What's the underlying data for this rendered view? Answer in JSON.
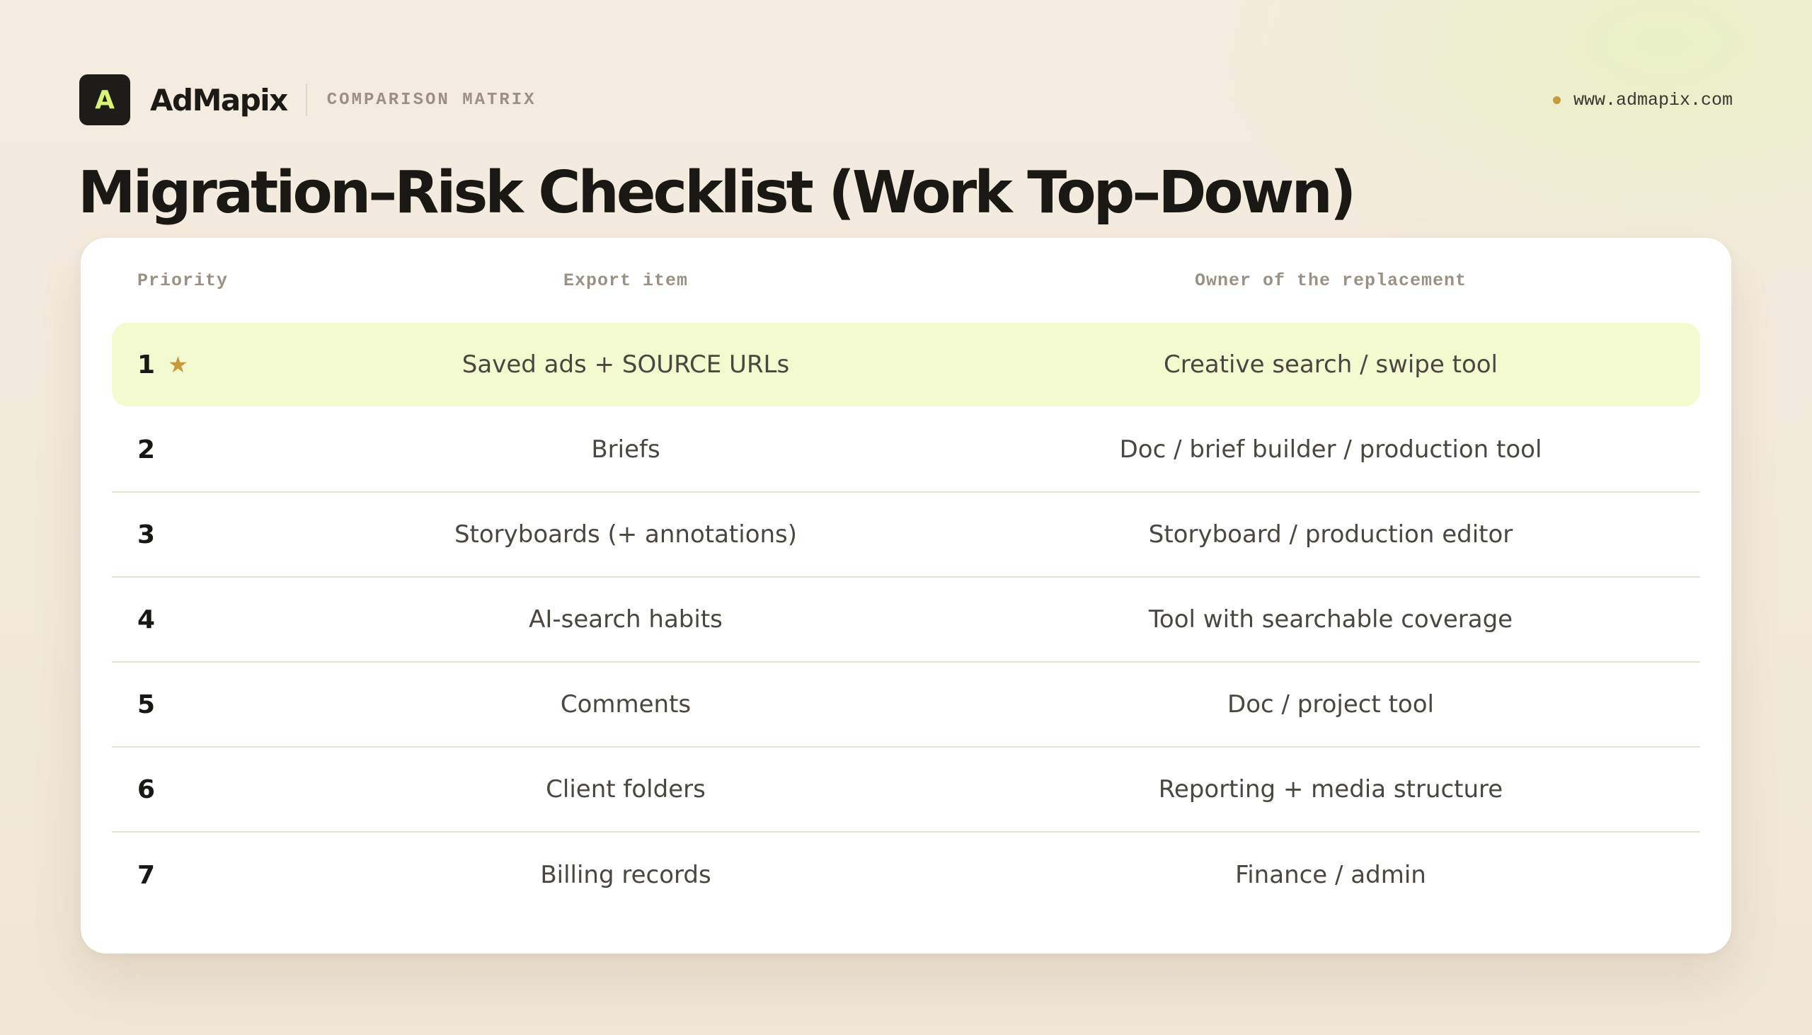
{
  "brand": {
    "logo_letter": "A",
    "name": "AdMapix",
    "tag": "COMPARISON MATRIX",
    "website": "www.admapix.com"
  },
  "page": {
    "title": "Migration–Risk Checklist (Work Top–Down)"
  },
  "table": {
    "headers": {
      "priority": "Priority",
      "export_item": "Export item",
      "owner": "Owner of the replacement"
    },
    "rows": [
      {
        "priority": "1",
        "export_item": "Saved ads + SOURCE URLs",
        "owner": "Creative search / swipe tool",
        "highlighted": true,
        "marker": "★"
      },
      {
        "priority": "2",
        "export_item": "Briefs",
        "owner": "Doc / brief builder / production tool"
      },
      {
        "priority": "3",
        "export_item": "Storyboards (+ annotations)",
        "owner": "Storyboard / production editor"
      },
      {
        "priority": "4",
        "export_item": "AI-search habits",
        "owner": "Tool with searchable coverage"
      },
      {
        "priority": "5",
        "export_item": "Comments",
        "owner": "Doc / project tool"
      },
      {
        "priority": "6",
        "export_item": "Client folders",
        "owner": "Reporting + media structure"
      },
      {
        "priority": "7",
        "export_item": "Billing records",
        "owner": "Finance / admin"
      }
    ]
  },
  "colors": {
    "accent_lime": "#d9f27a",
    "highlight_row": "#f3fad0",
    "gold": "#c49a3c",
    "ink": "#1a1814"
  }
}
